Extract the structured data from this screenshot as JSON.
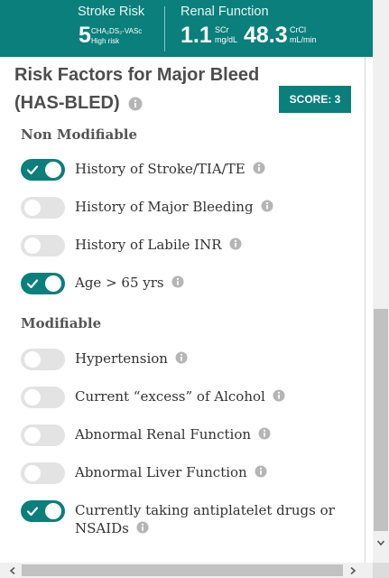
{
  "header": {
    "stroke": {
      "title": "Stroke Risk",
      "value": "5",
      "score_name": "CHA₂DS₂-VASc",
      "risk_label": "High risk"
    },
    "renal": {
      "title": "Renal Function",
      "scr_value": "1.1",
      "scr_label": "SCr",
      "scr_unit": "mg/dL",
      "crcl_value": "48.3",
      "crcl_label": "CrCl",
      "crcl_unit": "mL/min"
    }
  },
  "section": {
    "title": "Risk Factors for Major Bleed (HAS-BLED)",
    "score": "SCORE: 3"
  },
  "groups": {
    "non_modifiable": "Non Modifiable",
    "modifiable": "Modifiable"
  },
  "factors": [
    {
      "label": "History of Stroke/TIA/TE",
      "on": true
    },
    {
      "label": "History of Major Bleeding",
      "on": false
    },
    {
      "label": "History of Labile INR",
      "on": false
    },
    {
      "label": "Age > 65 yrs",
      "on": true
    },
    {
      "label": "Hypertension",
      "on": false
    },
    {
      "label": "Current “excess” of Alcohol",
      "on": false
    },
    {
      "label": "Abnormal Renal Function",
      "on": false
    },
    {
      "label": "Abnormal Liver Function",
      "on": false
    },
    {
      "label": "Currently taking antiplatelet drugs or NSAIDs",
      "on": true
    }
  ],
  "colors": {
    "accent": "#0a7f7c",
    "toggle_off": "#e3e3e3",
    "heading_text": "#4d4d4d"
  },
  "icons": [
    "info-icon",
    "check-icon",
    "scroll-arrow-icon"
  ]
}
